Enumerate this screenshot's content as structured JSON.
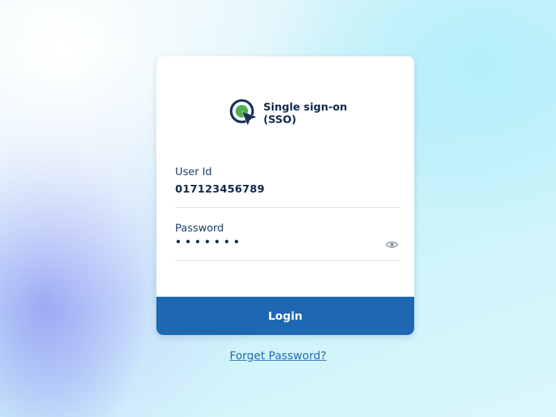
{
  "brand": {
    "title": "Single sign-on (SSO)",
    "logo_icon": "sso-target-cursor-icon"
  },
  "form": {
    "user_id": {
      "label": "User Id",
      "value": "017123456789"
    },
    "password": {
      "label": "Password",
      "masked_value": "•••••••",
      "toggle_icon": "eye-icon"
    }
  },
  "login_button": {
    "label": "Login"
  },
  "forget_password": {
    "label": "Forget Password?"
  },
  "colors": {
    "primary": "#1e67b3",
    "brand_dark": "#0f2b4a",
    "brand_green": "#4caf50",
    "link": "#2568b0"
  }
}
